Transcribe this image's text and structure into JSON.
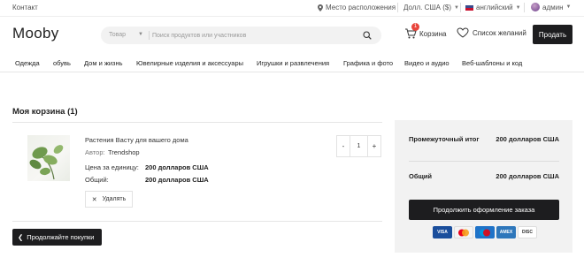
{
  "topbar": {
    "contact": "Контакт",
    "location": "Место расположения",
    "currency": "Долл. США ($)",
    "language": "английский",
    "user": "админ"
  },
  "header": {
    "logo": "Mooby",
    "search": {
      "category": "Товар",
      "placeholder": "Поиск продуктов или участников"
    },
    "cart_label": "Корзина",
    "cart_count": "1",
    "wishlist_label": "Список желаний",
    "sell_label": "Продать"
  },
  "nav": {
    "items": [
      "Одежда",
      "обувь",
      "Дом и жизнь",
      "Ювелирные изделия и аксессуары",
      "Игрушки и развлечения",
      "Графика и фото",
      "Видео и аудио",
      "Веб-шаблоны и код"
    ]
  },
  "cart": {
    "title": "Моя корзина (1)",
    "item": {
      "name": "Растения Васту для вашего дома",
      "author_label": "Автор:",
      "author": "Trendshop",
      "unit_price_label": "Цена за единицу:",
      "unit_price": "200 долларов США",
      "total_label": "Общий:",
      "total": "200 долларов США",
      "remove_label": "Удалять",
      "quantity": "1",
      "qty_minus": "-",
      "qty_plus": "+"
    },
    "continue_label": "Продолжайте покупки"
  },
  "summary": {
    "subtotal_label": "Промежуточный итог",
    "subtotal_value": "200 долларов США",
    "total_label": "Общий",
    "total_value": "200 долларов США",
    "checkout_label": "Продолжить оформление заказа",
    "cards": [
      {
        "name": "VISA",
        "color": "#1a4e9c"
      },
      {
        "name": "MC",
        "color": "#e9a21a"
      },
      {
        "name": "Maestro",
        "color": "#1f73c8"
      },
      {
        "name": "AMEX",
        "color": "#2e77bb"
      },
      {
        "name": "DISCOVER",
        "color": "#ffffff"
      }
    ]
  },
  "colors": {
    "accent_dark": "#1d1d1f",
    "badge": "#e8453c",
    "panel": "#f2f2f2"
  }
}
